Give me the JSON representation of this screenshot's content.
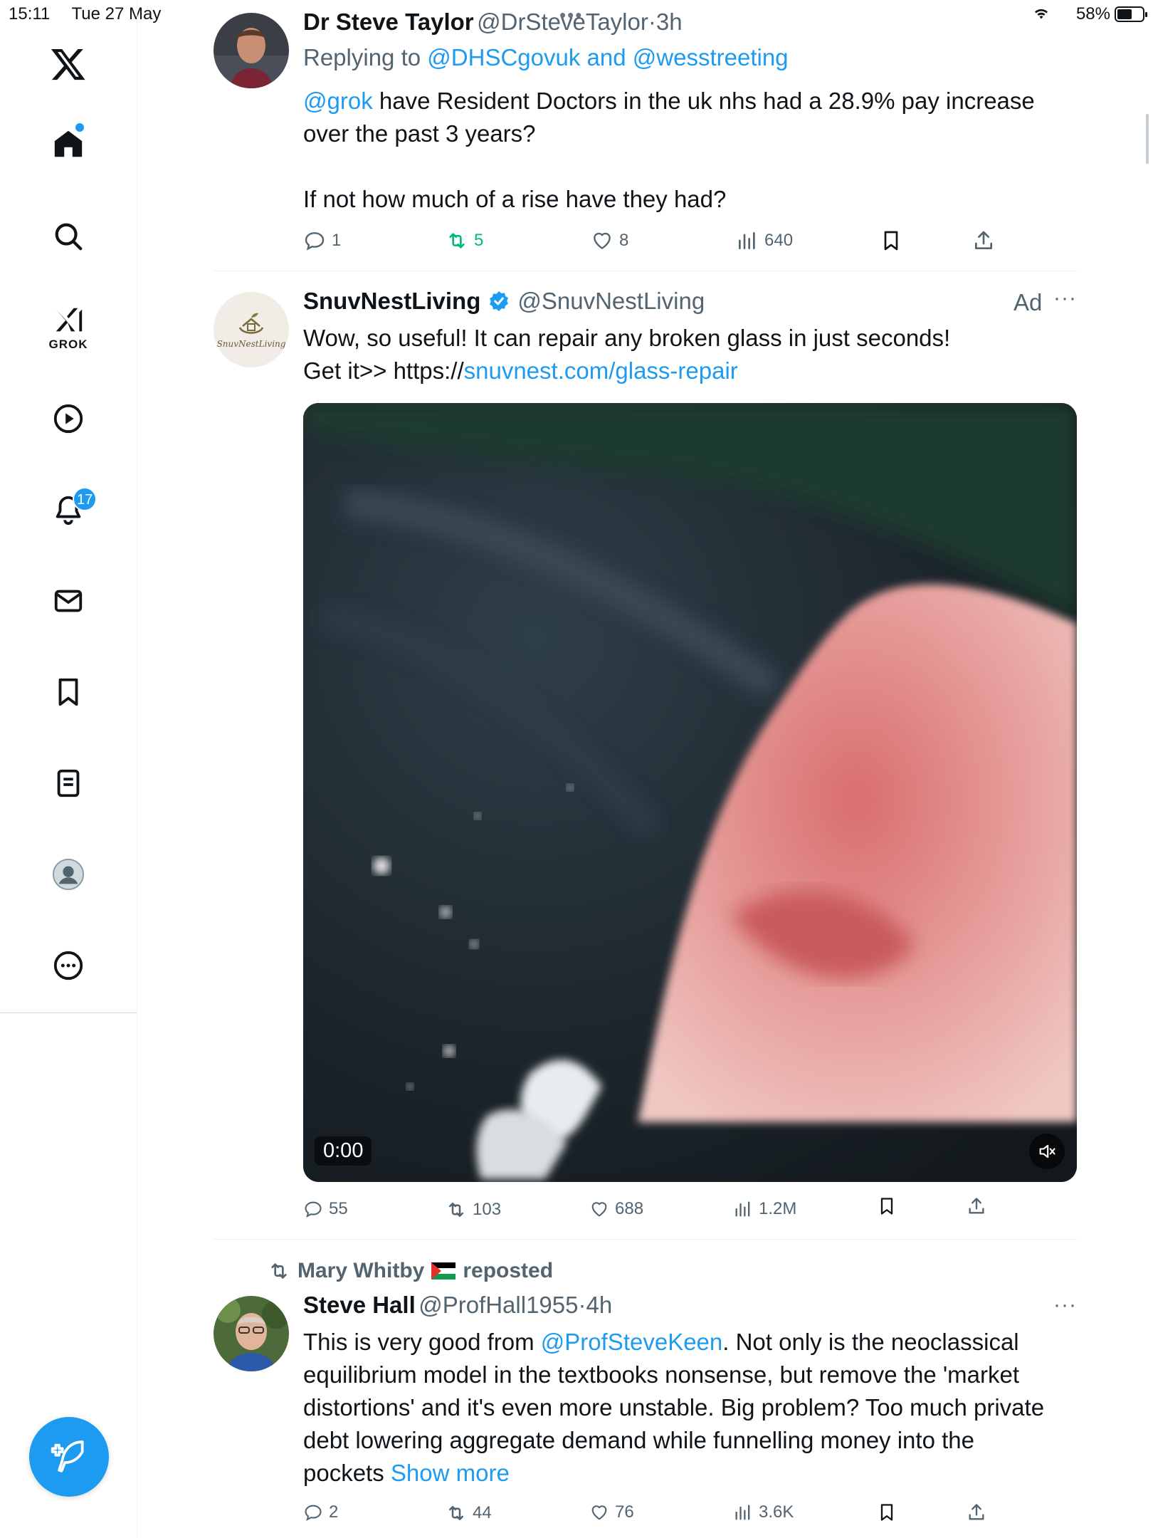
{
  "status_bar": {
    "time": "15:11",
    "date": "Tue 27 May",
    "battery": "58%",
    "battery_level": 0.58
  },
  "sidebar": {
    "items": [
      {
        "name": "x-logo"
      },
      {
        "name": "home"
      },
      {
        "name": "search"
      },
      {
        "name": "grok",
        "label": "GROK"
      },
      {
        "name": "video"
      },
      {
        "name": "notifications",
        "badge": "17"
      },
      {
        "name": "messages"
      },
      {
        "name": "bookmarks"
      },
      {
        "name": "lists"
      },
      {
        "name": "profile"
      },
      {
        "name": "more"
      }
    ],
    "compose_icon": "compose-feather-icon"
  },
  "tweets": [
    {
      "name": "Dr Steve Taylor",
      "handle": "@DrSteveTaylor",
      "dot": "·",
      "time": "3h",
      "replying_label": "Replying to",
      "replying_to_1": "@DHSCgovuk",
      "replying_and": "and",
      "replying_to_2": "@wesstreeting",
      "mention": "@grok",
      "text_line1": " have Resident Doctors in the uk nhs had a 28.9% pay increase",
      "text_line2": "over the past 3 years?",
      "text_line3": "If not how much of a rise have they had?",
      "stats": {
        "replies": "1",
        "reposts": "5",
        "likes": "8",
        "views": "640"
      }
    },
    {
      "name": "SnuvNestLiving",
      "handle": "@SnuvNestLiving",
      "ad_label": "Ad",
      "avatar_text": "SnuvNestLiving",
      "text_line1": "Wow, so useful! It can repair any broken glass in just seconds!",
      "text_line2_prefix": "Get it>> https://",
      "link": "snuvnest.com/glass-repair",
      "video_time": "0:00",
      "stats": {
        "replies": "55",
        "reposts": "103",
        "likes": "688",
        "views": "1.2M"
      }
    },
    {
      "reposted_by": "Mary Whitby",
      "reposted_label": "reposted",
      "name": "Steve Hall",
      "handle": "@ProfHall1955",
      "dot": "·",
      "time": "4h",
      "text_prefix": "This is very good from ",
      "mention": "@ProfSteveKeen",
      "text_l1_suffix": ". Not only is the neoclassical",
      "text_l2": "equilibrium model in the textbooks nonsense, but remove the 'market",
      "text_l3": "distortions' and it's even more unstable. Big problem? Too much private",
      "text_l4": "debt lowering aggregate demand while funnelling money into the",
      "text_l5": "pockets",
      "show_more": "Show more",
      "stats": {
        "replies": "2",
        "reposts": "44",
        "likes": "76",
        "views": "3.6K"
      }
    }
  ],
  "colors": {
    "accent": "#1d9bf0",
    "text": "#0f1419",
    "secondary": "#536471",
    "repost_active": "#00ba7c"
  }
}
